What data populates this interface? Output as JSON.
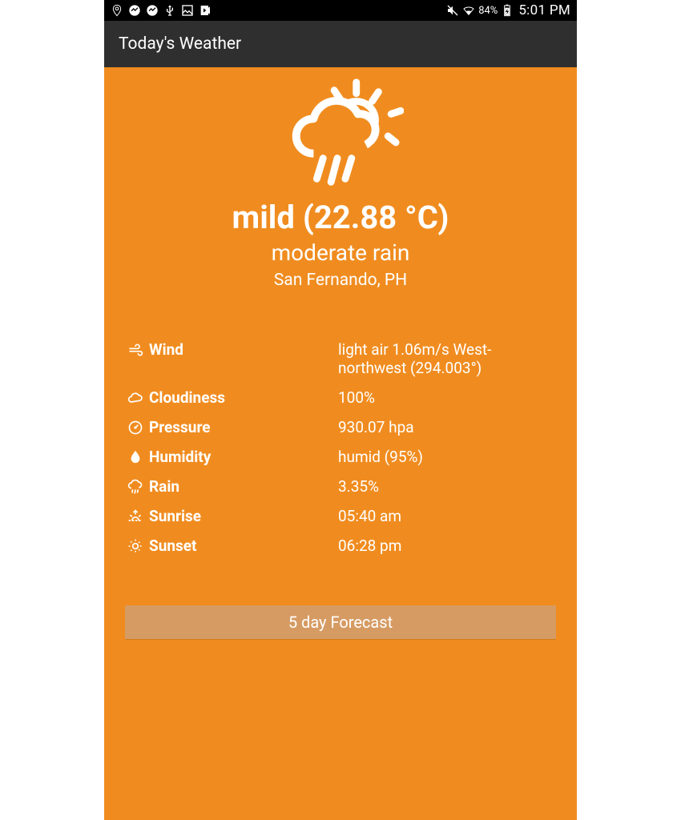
{
  "status_bar": {
    "battery_pct": "84%",
    "clock": "5:01 PM"
  },
  "app_bar": {
    "title": "Today's Weather"
  },
  "hero": {
    "temp_line": "mild (22.88 °C)",
    "condition": "moderate rain",
    "location": "San Fernando, PH"
  },
  "details": {
    "wind": {
      "label": "Wind",
      "value": "light air 1.06m/s West-northwest (294.003°)"
    },
    "cloudiness": {
      "label": "Cloudiness",
      "value": "100%"
    },
    "pressure": {
      "label": "Pressure",
      "value": "930.07 hpa"
    },
    "humidity": {
      "label": "Humidity",
      "value": "humid (95%)"
    },
    "rain": {
      "label": "Rain",
      "value": "3.35%"
    },
    "sunrise": {
      "label": "Sunrise",
      "value": "05:40 am"
    },
    "sunset": {
      "label": "Sunset",
      "value": "06:28 pm"
    }
  },
  "buttons": {
    "forecast": "5 day Forecast"
  }
}
